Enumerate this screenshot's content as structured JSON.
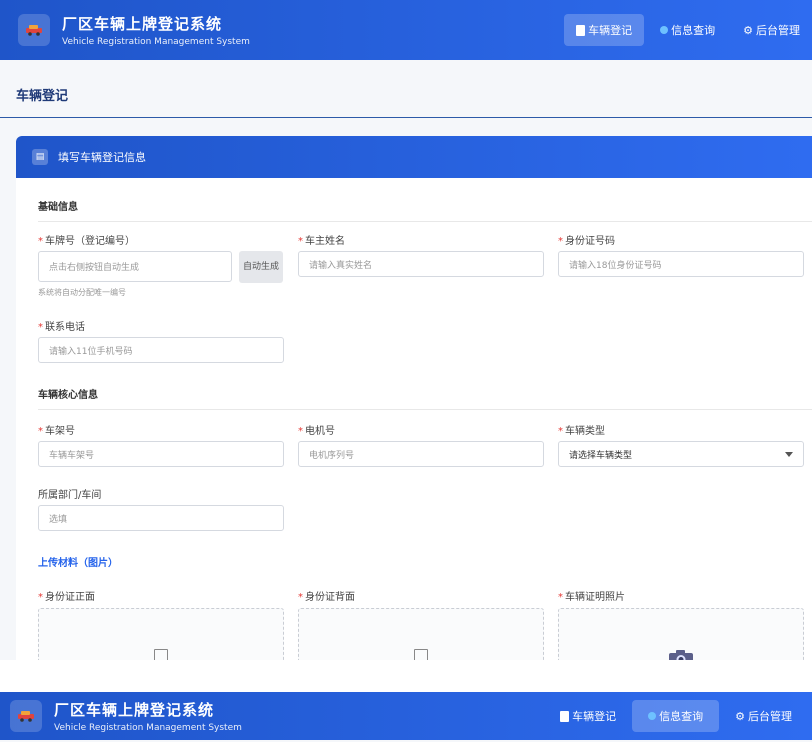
{
  "app": {
    "title": "厂区车辆上牌登记系统",
    "subtitle": "Vehicle Registration Management System",
    "logo_icon": "car-icon"
  },
  "nav": [
    {
      "label": "车辆登记",
      "icon": "document-icon"
    },
    {
      "label": "信息查询",
      "icon": "globe-icon"
    },
    {
      "label": "后台管理",
      "icon": "gear-icon"
    }
  ],
  "page": {
    "title": "车辆登记"
  },
  "card": {
    "title": "填写车辆登记信息",
    "icon": "document-icon"
  },
  "sections": {
    "basic": "基础信息",
    "vehicle": "车辆核心信息",
    "upload": "上传材料（图片）"
  },
  "fields": {
    "plate": {
      "label": "车牌号（登记编号）",
      "placeholder": "点击右侧按钮自动生成",
      "button": "自动生成",
      "hint": "系统将自动分配唯一编号"
    },
    "owner": {
      "label": "车主姓名",
      "placeholder": "请输入真实姓名"
    },
    "idcard": {
      "label": "身份证号码",
      "placeholder": "请输入18位身份证号码"
    },
    "phone": {
      "label": "联系电话",
      "placeholder": "请输入11位手机号码"
    },
    "vin": {
      "label": "车架号",
      "placeholder": "车辆车架号"
    },
    "engine": {
      "label": "电机号",
      "placeholder": "电机序列号"
    },
    "vtype": {
      "label": "车辆类型",
      "value": "请选择车辆类型"
    },
    "dept": {
      "label": "所属部门/车间",
      "placeholder": "选填"
    }
  },
  "uploads": [
    {
      "label": "身份证正面",
      "icon": "placeholder-glyph-icon"
    },
    {
      "label": "身份证背面",
      "icon": "placeholder-glyph-icon"
    },
    {
      "label": "车辆证明照片",
      "icon": "camera-icon"
    }
  ],
  "colors": {
    "primary": "#2f6cf0",
    "required": "#e53935",
    "section_blue": "#2563eb"
  }
}
